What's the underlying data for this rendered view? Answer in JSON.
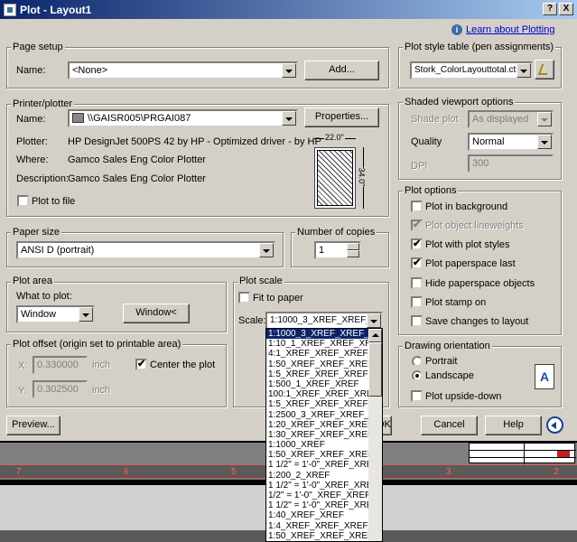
{
  "window": {
    "title": "Plot - Layout1",
    "help_button": "?",
    "close_button": "X"
  },
  "info_link": "Learn about Plotting",
  "page_setup": {
    "group": "Page setup",
    "name_label": "Name:",
    "name_value": "<None>",
    "add_button": "Add..."
  },
  "printer": {
    "group": "Printer/plotter",
    "name_label": "Name:",
    "name_value": "\\\\GAISR005\\PRGAI087",
    "properties_button": "Properties...",
    "plotter_label": "Plotter:",
    "plotter_value": "HP DesignJet 500PS 42 by HP - Optimized driver - by HP",
    "where_label": "Where:",
    "where_value": "Gamco Sales Eng Color Plotter",
    "description_label": "Description:",
    "description_value": "Gamco Sales Eng Color Plotter",
    "plot_to_file": "Plot to file",
    "preview_width": "22.0\"",
    "preview_height": "34.0\""
  },
  "paper_size": {
    "group": "Paper size",
    "value": "ANSI D (portrait)"
  },
  "copies": {
    "group": "Number of copies",
    "value": "1"
  },
  "plot_area": {
    "group": "Plot area",
    "what_label": "What to plot:",
    "what_value": "Window",
    "window_button": "Window<"
  },
  "plot_offset": {
    "group": "Plot offset (origin set to printable area)",
    "x_label": "X:",
    "x_value": "0.330000",
    "x_unit": "inch",
    "y_label": "Y:",
    "y_value": "0.302500",
    "y_unit": "inch",
    "center": "Center the plot"
  },
  "plot_scale": {
    "group": "Plot scale",
    "fit": "Fit to paper",
    "scale_label": "Scale:",
    "scale_value": "1:1000_3_XREF_XREF_XR"
  },
  "scale_list": [
    "1:1000_3_XREF_XREF_XR",
    "1:10_1_XREF_XREF_XREF",
    "4:1_XREF_XREF_XREF_XR",
    "1:50_XREF_XREF_XREF_XF",
    "1:5_XREF_XREF_XREF_XRE",
    "1:500_1_XREF_XREF",
    "100:1_XREF_XREF_XREF_X",
    "1:5_XREF_XREF_XREF_XRE",
    "1:2500_3_XREF_XREF_XRE",
    "1:20_XREF_XREF_XREF_XRE",
    "1:30_XREF_XREF_XREF_XRE",
    "1:1000_XREF",
    "1:50_XREF_XREF_XREF_XF",
    "1 1/2\" = 1'-0\"_XREF_XREF",
    "1:200_2_XREF",
    "1 1/2\" = 1'-0\"_XREF_XREF",
    "1/2\" = 1'-0\"_XREF_XREF_X",
    "1 1/2\" = 1'-0\"_XREF_XREF",
    "1:40_XREF_XREF",
    "1:4_XREF_XREF_XREF_XRE",
    "1:50_XREF_XREF_XREF_XF"
  ],
  "style_table": {
    "group": "Plot style table (pen assignments)",
    "value": "Stork_ColorLayouttotal.ctb"
  },
  "shaded": {
    "group": "Shaded viewport options",
    "shade_label": "Shade plot",
    "shade_value": "As displayed",
    "quality_label": "Quality",
    "quality_value": "Normal",
    "dpi_label": "DPI",
    "dpi_value": "300"
  },
  "plot_options": {
    "group": "Plot options",
    "items": [
      {
        "label": "Plot in background",
        "checked": ""
      },
      {
        "label": "Plot object lineweights",
        "checked": "✔"
      },
      {
        "label": "Plot with plot styles",
        "checked": "✔"
      },
      {
        "label": "Plot paperspace last",
        "checked": "✔"
      },
      {
        "label": "Hide paperspace objects",
        "checked": ""
      },
      {
        "label": "Plot stamp on",
        "checked": ""
      },
      {
        "label": "Save changes to layout",
        "checked": ""
      }
    ]
  },
  "orientation": {
    "group": "Drawing orientation",
    "portrait": "Portrait",
    "landscape": "Landscape",
    "upside": "Plot upside-down",
    "icon_letter": "A"
  },
  "bottom": {
    "preview": "Preview...",
    "ok": "OK",
    "cancel": "Cancel",
    "help": "Help"
  },
  "ruler_numbers": [
    "7",
    "6",
    "5",
    "3",
    "2"
  ]
}
